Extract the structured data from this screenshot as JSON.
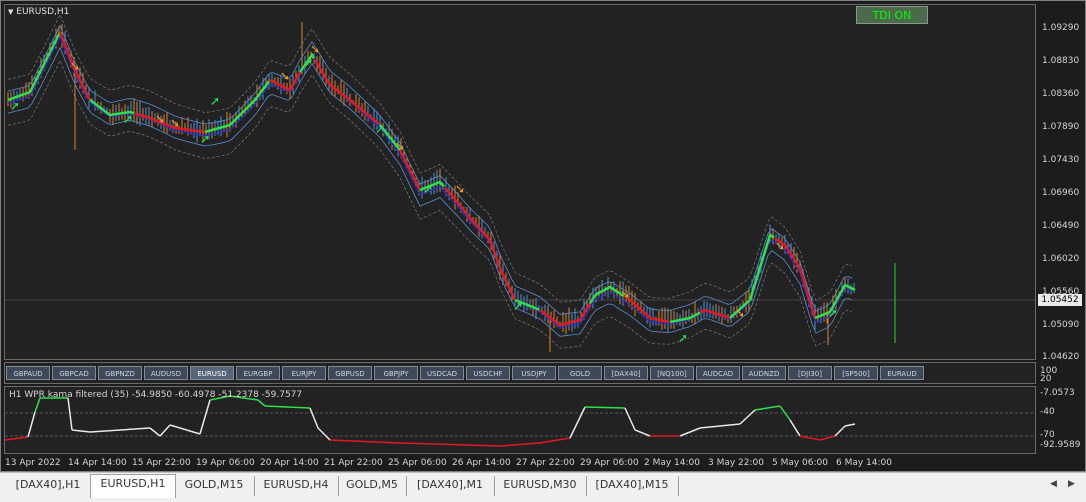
{
  "chart": {
    "title": "EURUSD,H1",
    "tdi_button": "TDI ON",
    "current_price": "1.05452",
    "price_labels": [
      "1.09290",
      "1.08830",
      "1.08360",
      "1.07890",
      "1.07430",
      "1.06960",
      "1.06490",
      "1.06020",
      "1.05560",
      "1.05090",
      "1.04620"
    ],
    "colors": {
      "bull": "#4a90d9",
      "bear": "#d9822b",
      "line_green": "#2ee04a",
      "line_red": "#e01a22",
      "line_blue": "#2c2cc0",
      "arrow_up": "#2ee04a",
      "arrow_down": "#f59a1a"
    }
  },
  "symbol_buttons": [
    "GBPAUD",
    "GBPCAD",
    "GBPNZD",
    "AUDUSD",
    "EURUSD",
    "EURGBP",
    "EURJPY",
    "GBPUSD",
    "GBPJPY",
    "USDCAD",
    "USDCHF",
    "USDJPY",
    "GOLD",
    "[DAX40]",
    "[NQ100]",
    "AUDCAD",
    "AUDNZD",
    "[DJI30]",
    "[SP500]",
    "EURAUD"
  ],
  "symbol_active": "EURUSD",
  "indicator": {
    "title": "H1  WPR kama filtered (35) -54.9850 -60.4978 -51.2378 -59.7577",
    "scale_labels": [
      "100",
      "20",
      "-7.0573",
      "-40",
      "-70",
      "-92.9589"
    ]
  },
  "time_labels": [
    "13 Apr 2022",
    "14 Apr 14:00",
    "15 Apr 22:00",
    "19 Apr 06:00",
    "20 Apr 14:00",
    "21 Apr 22:00",
    "25 Apr 06:00",
    "26 Apr 14:00",
    "27 Apr 22:00",
    "29 Apr 06:00",
    "2 May 14:00",
    "3 May 22:00",
    "5 May 06:00",
    "6 May 14:00"
  ],
  "tabs": [
    "[DAX40],H1",
    "EURUSD,H1",
    "GOLD,M15",
    "EURUSD,H4",
    "GOLD,M5",
    "[DAX40],M1",
    "EURUSD,M30",
    "[DAX40],M15"
  ],
  "active_tab": "EURUSD,H1"
}
